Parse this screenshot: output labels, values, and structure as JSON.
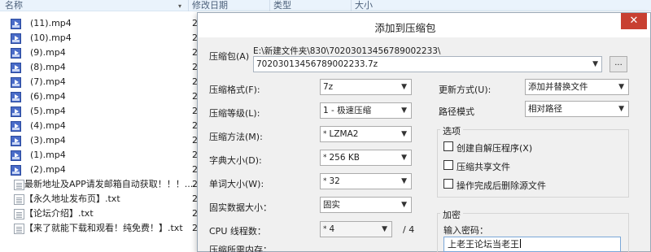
{
  "explorer": {
    "columns": {
      "name": "名称",
      "date": "修改日期",
      "type": "类型",
      "size": "大小"
    },
    "files": [
      {
        "name": "(11).mp4",
        "date": "2",
        "kind": "video"
      },
      {
        "name": "(10).mp4",
        "date": "2",
        "kind": "video"
      },
      {
        "name": "(9).mp4",
        "date": "2",
        "kind": "video"
      },
      {
        "name": "(8).mp4",
        "date": "2",
        "kind": "video"
      },
      {
        "name": "(7).mp4",
        "date": "2",
        "kind": "video"
      },
      {
        "name": "(6).mp4",
        "date": "2",
        "kind": "video"
      },
      {
        "name": "(5).mp4",
        "date": "2",
        "kind": "video"
      },
      {
        "name": "(4).mp4",
        "date": "2",
        "kind": "video"
      },
      {
        "name": "(3).mp4",
        "date": "2",
        "kind": "video"
      },
      {
        "name": "(1).mp4",
        "date": "2",
        "kind": "video"
      },
      {
        "name": "(2).mp4",
        "date": "2",
        "kind": "video"
      },
      {
        "name": "最新地址及APP请发邮箱自动获取！！！....",
        "date": "2",
        "kind": "text"
      },
      {
        "name": "【永久地址发布页】.txt",
        "date": "2",
        "kind": "text"
      },
      {
        "name": "【论坛介绍】.txt",
        "date": "2",
        "kind": "text"
      },
      {
        "name": "【来了就能下载和观看！纯免费！】.txt",
        "date": "2",
        "kind": "text"
      }
    ]
  },
  "dialog": {
    "title": "添加到压缩包",
    "close_glyph": "✕",
    "archive": {
      "label": "压缩包(A)",
      "path": "E:\\新建文件夹\\830\\70203013456789002233\\",
      "filename": "70203013456789002233.7z",
      "browse_label": "..."
    },
    "left": {
      "format": {
        "label": "压缩格式(F):",
        "value": "7z"
      },
      "level": {
        "label": "压缩等级(L):",
        "value": "1 - 极速压缩"
      },
      "method": {
        "label": "压缩方法(M):",
        "value": "LZMA2"
      },
      "dict": {
        "label": "字典大小(D):",
        "value": "256 KB"
      },
      "word": {
        "label": "单词大小(W):",
        "value": "32"
      },
      "solid": {
        "label": "固实数据大小：",
        "value": "固实"
      },
      "threads": {
        "label": "CPU 线程数：",
        "value": "4",
        "max": "/ 4"
      },
      "memory": {
        "label": "压缩所需内存："
      }
    },
    "right": {
      "update": {
        "label": "更新方式(U):",
        "value": "添加并替换文件"
      },
      "pathmode": {
        "label": "路径模式",
        "value": "相对路径"
      },
      "options": {
        "title": "选项",
        "sfx": "创建自解压程序(X)",
        "shared": "压缩共享文件",
        "delete": "操作完成后删除源文件"
      },
      "encryption": {
        "title": "加密",
        "pwd_label": "输入密码：",
        "pwd_value": "上老王论坛当老王"
      }
    }
  },
  "colors": {
    "close": "#c84031",
    "header_bg": "#eaf3fc",
    "dialog_bg": "#f0f0f0"
  }
}
